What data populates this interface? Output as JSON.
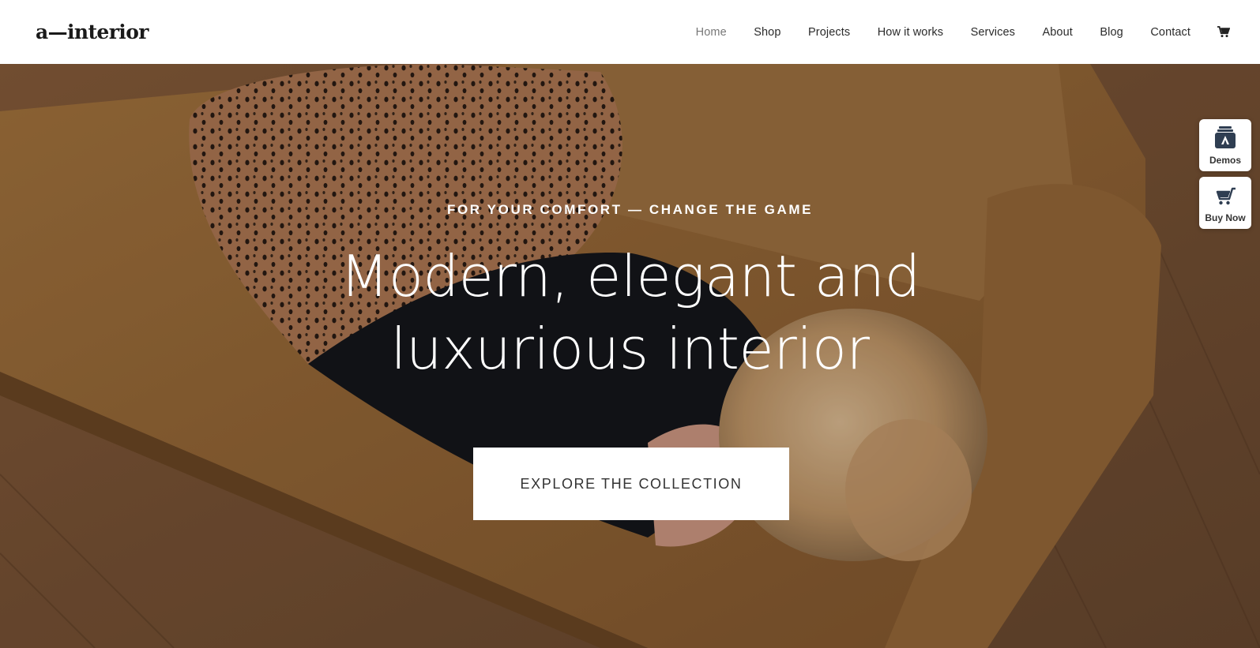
{
  "brand": {
    "logo_text": "a—interior"
  },
  "nav": {
    "items": [
      {
        "label": "Home",
        "active": true
      },
      {
        "label": "Shop",
        "active": false
      },
      {
        "label": "Projects",
        "active": false
      },
      {
        "label": "How it works",
        "active": false
      },
      {
        "label": "Services",
        "active": false
      },
      {
        "label": "About",
        "active": false
      },
      {
        "label": "Blog",
        "active": false
      },
      {
        "label": "Contact",
        "active": false
      }
    ],
    "cart_icon": "shopping-cart-icon"
  },
  "hero": {
    "eyebrow": "FOR YOUR COMFORT — CHANGE THE GAME",
    "headline_line1": "Modern, elegant and",
    "headline_line2": "luxurious interior",
    "cta_label": "EXPLORE THE COLLECTION"
  },
  "side_widgets": {
    "demos": {
      "label": "Demos",
      "icon": "demos-stack-icon"
    },
    "buy_now": {
      "label": "Buy Now",
      "icon": "shopping-cart-icon"
    }
  },
  "colors": {
    "accent_text": "#ffffff",
    "nav_active": "#777777",
    "sofa": "#9a6c3f",
    "floor": "#7a5234",
    "widget_icon": "#2f3e52"
  }
}
